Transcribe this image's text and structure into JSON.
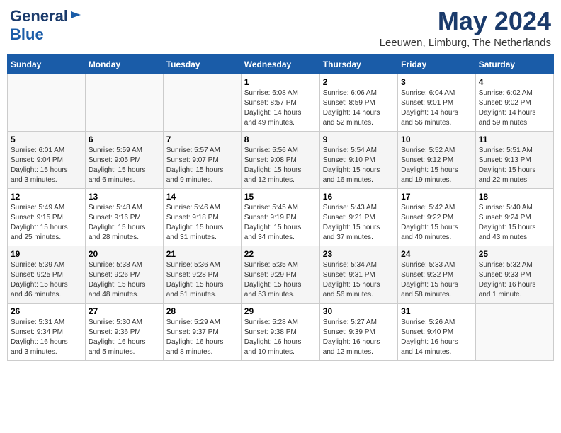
{
  "header": {
    "logo_line1": "General",
    "logo_line2": "Blue",
    "month_year": "May 2024",
    "location": "Leeuwen, Limburg, The Netherlands"
  },
  "calendar": {
    "days_of_week": [
      "Sunday",
      "Monday",
      "Tuesday",
      "Wednesday",
      "Thursday",
      "Friday",
      "Saturday"
    ],
    "weeks": [
      [
        {
          "day": "",
          "info": ""
        },
        {
          "day": "",
          "info": ""
        },
        {
          "day": "",
          "info": ""
        },
        {
          "day": "1",
          "info": "Sunrise: 6:08 AM\nSunset: 8:57 PM\nDaylight: 14 hours\nand 49 minutes."
        },
        {
          "day": "2",
          "info": "Sunrise: 6:06 AM\nSunset: 8:59 PM\nDaylight: 14 hours\nand 52 minutes."
        },
        {
          "day": "3",
          "info": "Sunrise: 6:04 AM\nSunset: 9:01 PM\nDaylight: 14 hours\nand 56 minutes."
        },
        {
          "day": "4",
          "info": "Sunrise: 6:02 AM\nSunset: 9:02 PM\nDaylight: 14 hours\nand 59 minutes."
        }
      ],
      [
        {
          "day": "5",
          "info": "Sunrise: 6:01 AM\nSunset: 9:04 PM\nDaylight: 15 hours\nand 3 minutes."
        },
        {
          "day": "6",
          "info": "Sunrise: 5:59 AM\nSunset: 9:05 PM\nDaylight: 15 hours\nand 6 minutes."
        },
        {
          "day": "7",
          "info": "Sunrise: 5:57 AM\nSunset: 9:07 PM\nDaylight: 15 hours\nand 9 minutes."
        },
        {
          "day": "8",
          "info": "Sunrise: 5:56 AM\nSunset: 9:08 PM\nDaylight: 15 hours\nand 12 minutes."
        },
        {
          "day": "9",
          "info": "Sunrise: 5:54 AM\nSunset: 9:10 PM\nDaylight: 15 hours\nand 16 minutes."
        },
        {
          "day": "10",
          "info": "Sunrise: 5:52 AM\nSunset: 9:12 PM\nDaylight: 15 hours\nand 19 minutes."
        },
        {
          "day": "11",
          "info": "Sunrise: 5:51 AM\nSunset: 9:13 PM\nDaylight: 15 hours\nand 22 minutes."
        }
      ],
      [
        {
          "day": "12",
          "info": "Sunrise: 5:49 AM\nSunset: 9:15 PM\nDaylight: 15 hours\nand 25 minutes."
        },
        {
          "day": "13",
          "info": "Sunrise: 5:48 AM\nSunset: 9:16 PM\nDaylight: 15 hours\nand 28 minutes."
        },
        {
          "day": "14",
          "info": "Sunrise: 5:46 AM\nSunset: 9:18 PM\nDaylight: 15 hours\nand 31 minutes."
        },
        {
          "day": "15",
          "info": "Sunrise: 5:45 AM\nSunset: 9:19 PM\nDaylight: 15 hours\nand 34 minutes."
        },
        {
          "day": "16",
          "info": "Sunrise: 5:43 AM\nSunset: 9:21 PM\nDaylight: 15 hours\nand 37 minutes."
        },
        {
          "day": "17",
          "info": "Sunrise: 5:42 AM\nSunset: 9:22 PM\nDaylight: 15 hours\nand 40 minutes."
        },
        {
          "day": "18",
          "info": "Sunrise: 5:40 AM\nSunset: 9:24 PM\nDaylight: 15 hours\nand 43 minutes."
        }
      ],
      [
        {
          "day": "19",
          "info": "Sunrise: 5:39 AM\nSunset: 9:25 PM\nDaylight: 15 hours\nand 46 minutes."
        },
        {
          "day": "20",
          "info": "Sunrise: 5:38 AM\nSunset: 9:26 PM\nDaylight: 15 hours\nand 48 minutes."
        },
        {
          "day": "21",
          "info": "Sunrise: 5:36 AM\nSunset: 9:28 PM\nDaylight: 15 hours\nand 51 minutes."
        },
        {
          "day": "22",
          "info": "Sunrise: 5:35 AM\nSunset: 9:29 PM\nDaylight: 15 hours\nand 53 minutes."
        },
        {
          "day": "23",
          "info": "Sunrise: 5:34 AM\nSunset: 9:31 PM\nDaylight: 15 hours\nand 56 minutes."
        },
        {
          "day": "24",
          "info": "Sunrise: 5:33 AM\nSunset: 9:32 PM\nDaylight: 15 hours\nand 58 minutes."
        },
        {
          "day": "25",
          "info": "Sunrise: 5:32 AM\nSunset: 9:33 PM\nDaylight: 16 hours\nand 1 minute."
        }
      ],
      [
        {
          "day": "26",
          "info": "Sunrise: 5:31 AM\nSunset: 9:34 PM\nDaylight: 16 hours\nand 3 minutes."
        },
        {
          "day": "27",
          "info": "Sunrise: 5:30 AM\nSunset: 9:36 PM\nDaylight: 16 hours\nand 5 minutes."
        },
        {
          "day": "28",
          "info": "Sunrise: 5:29 AM\nSunset: 9:37 PM\nDaylight: 16 hours\nand 8 minutes."
        },
        {
          "day": "29",
          "info": "Sunrise: 5:28 AM\nSunset: 9:38 PM\nDaylight: 16 hours\nand 10 minutes."
        },
        {
          "day": "30",
          "info": "Sunrise: 5:27 AM\nSunset: 9:39 PM\nDaylight: 16 hours\nand 12 minutes."
        },
        {
          "day": "31",
          "info": "Sunrise: 5:26 AM\nSunset: 9:40 PM\nDaylight: 16 hours\nand 14 minutes."
        },
        {
          "day": "",
          "info": ""
        }
      ]
    ]
  }
}
